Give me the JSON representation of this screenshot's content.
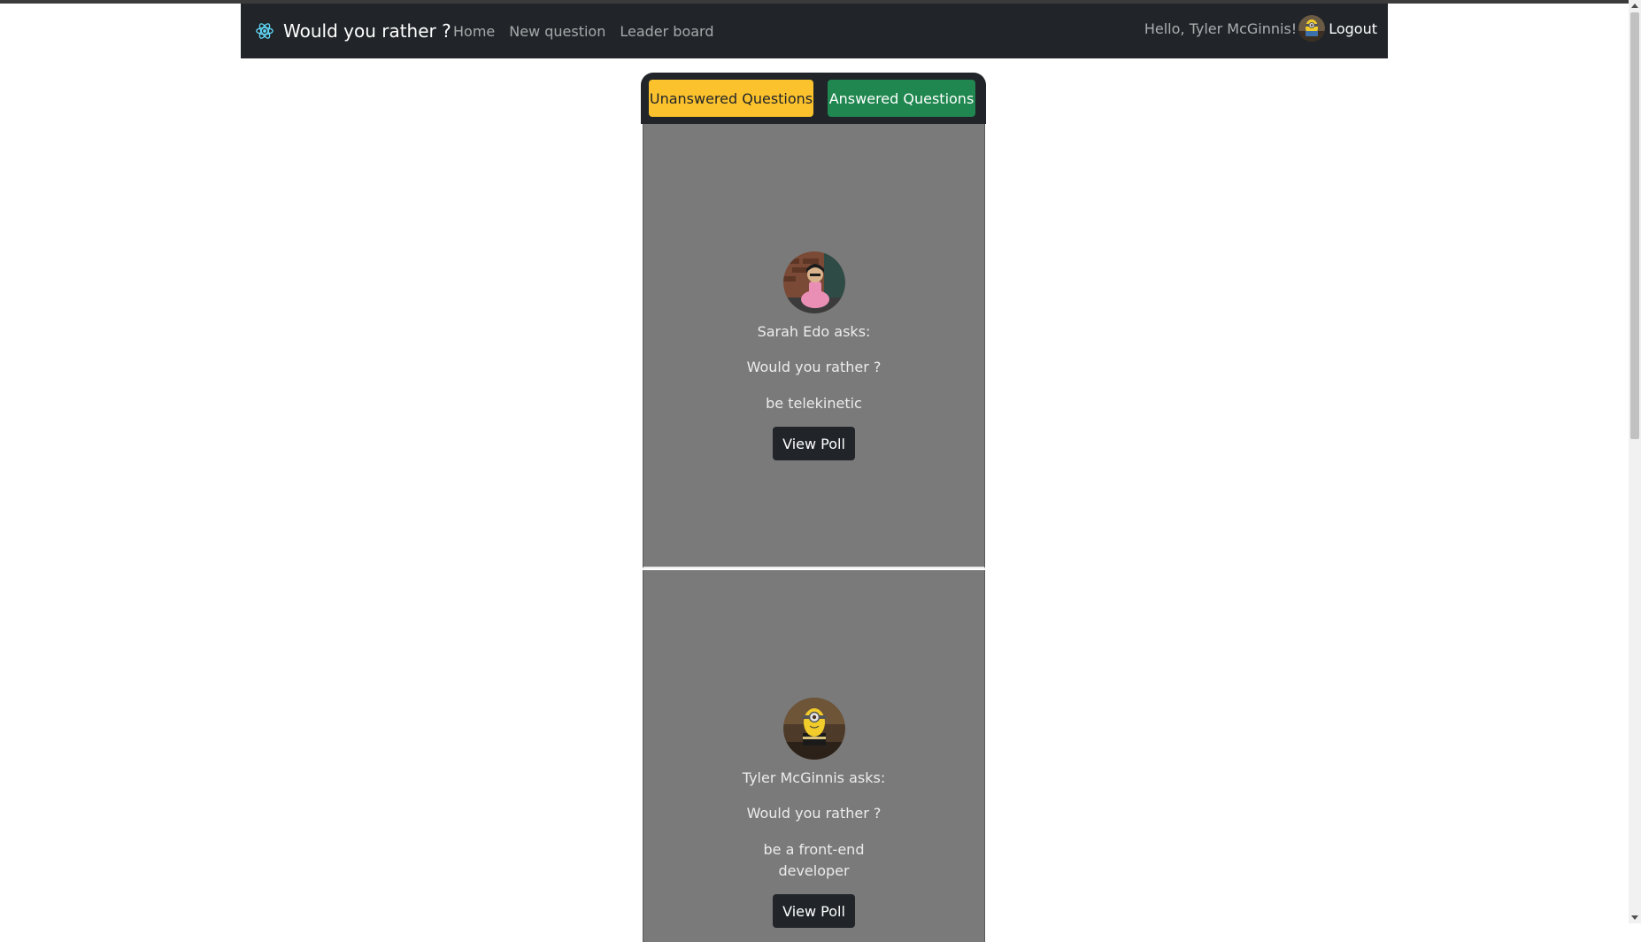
{
  "navbar": {
    "brand_icon": "react-atom-icon",
    "brand_text": "Would you rather ?",
    "links": [
      "Home",
      "New question",
      "Leader board"
    ],
    "greeting": "Hello, Tyler McGinnis!",
    "logout_label": "Logout"
  },
  "tabs": {
    "unanswered_label": "Unanswered Questions",
    "answered_label": "Answered Questions"
  },
  "questions": [
    {
      "asker": "Sarah Edo asks:",
      "prompt": "Would you rather ?",
      "option": "be telekinetic",
      "button_label": "View Poll"
    },
    {
      "asker": "Tyler McGinnis asks:",
      "prompt": "Would you rather ?",
      "option": "be a front-end developer",
      "button_label": "View Poll"
    }
  ],
  "colors": {
    "navbar_bg": "#212529",
    "unanswered_tab": "#fcc22d",
    "answered_tab": "#1f874f",
    "card_bg": "#7a7a7a"
  }
}
